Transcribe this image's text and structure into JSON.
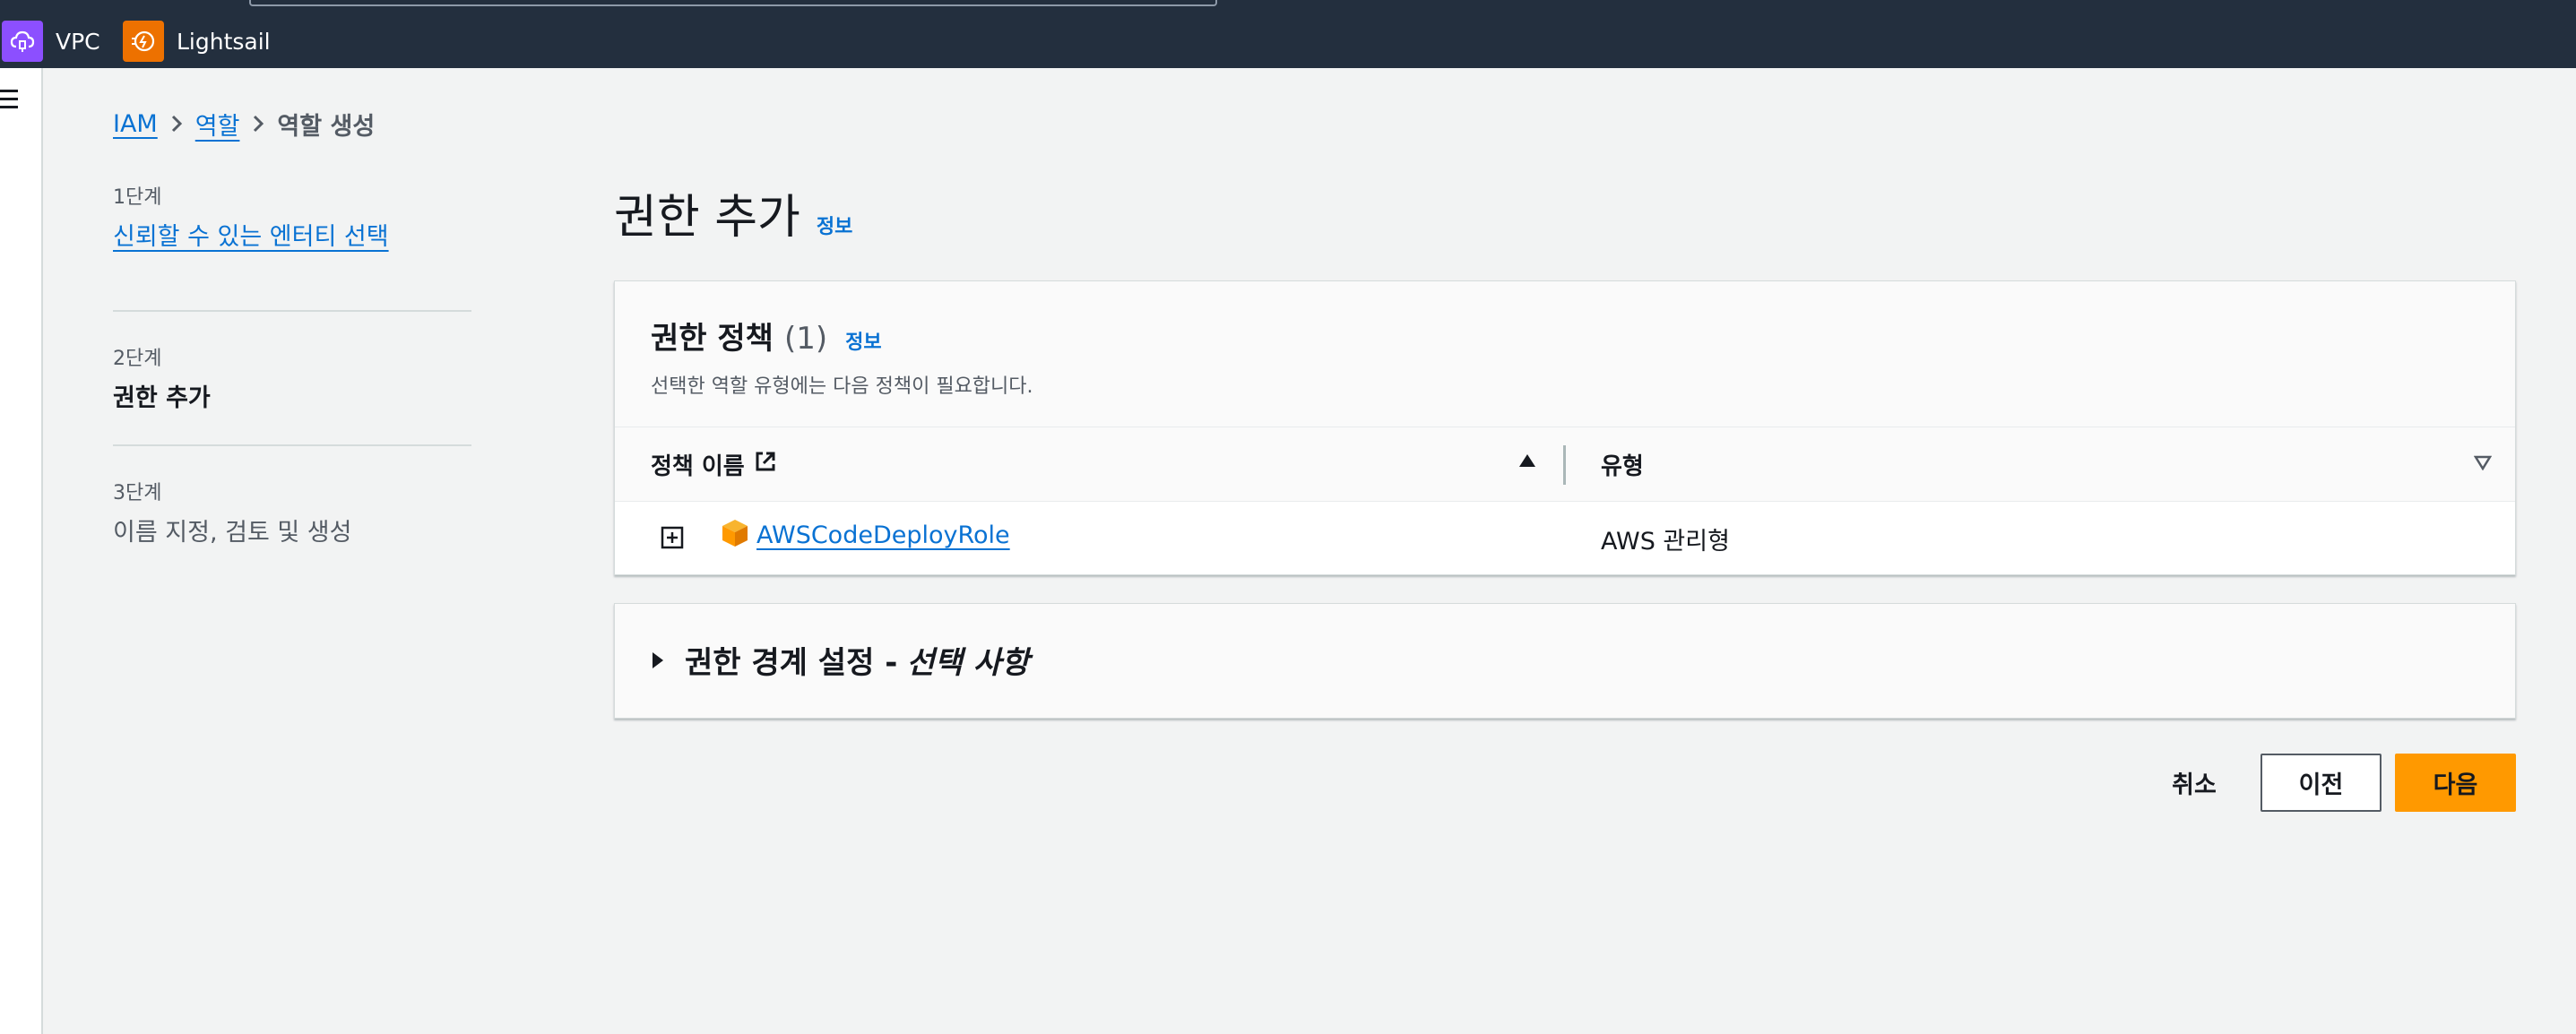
{
  "topnav": {
    "services": [
      {
        "label": "VPC",
        "icon": "vpc-cloud-icon",
        "color": "#8c4fff"
      },
      {
        "label": "Lightsail",
        "icon": "lightsail-icon",
        "color": "#ed7100"
      }
    ]
  },
  "breadcrumb": {
    "items": [
      "IAM",
      "역할",
      "역할 생성"
    ]
  },
  "steps": [
    {
      "num": "1단계",
      "title": "신뢰할 수 있는 엔터티 선택",
      "state": "link"
    },
    {
      "num": "2단계",
      "title": "권한 추가",
      "state": "active"
    },
    {
      "num": "3단계",
      "title": "이름 지정, 검토 및 생성",
      "state": "disabled"
    }
  ],
  "page": {
    "title": "권한 추가",
    "info": "정보"
  },
  "policies": {
    "title": "권한 정책",
    "count": "(1)",
    "info": "정보",
    "description": "선택한 역할 유형에는 다음 정책이 필요합니다.",
    "columns": [
      "정책 이름",
      "유형"
    ],
    "rows": [
      {
        "name": "AWSCodeDeployRole",
        "type": "AWS 관리형"
      }
    ]
  },
  "boundary": {
    "title": "권한 경계 설정 -",
    "optional": "선택 사항"
  },
  "actions": {
    "cancel": "취소",
    "previous": "이전",
    "next": "다음"
  },
  "colors": {
    "topnav": "#232f3e",
    "link": "#0972d3",
    "primary": "#ff9900",
    "background": "#f2f3f3"
  }
}
